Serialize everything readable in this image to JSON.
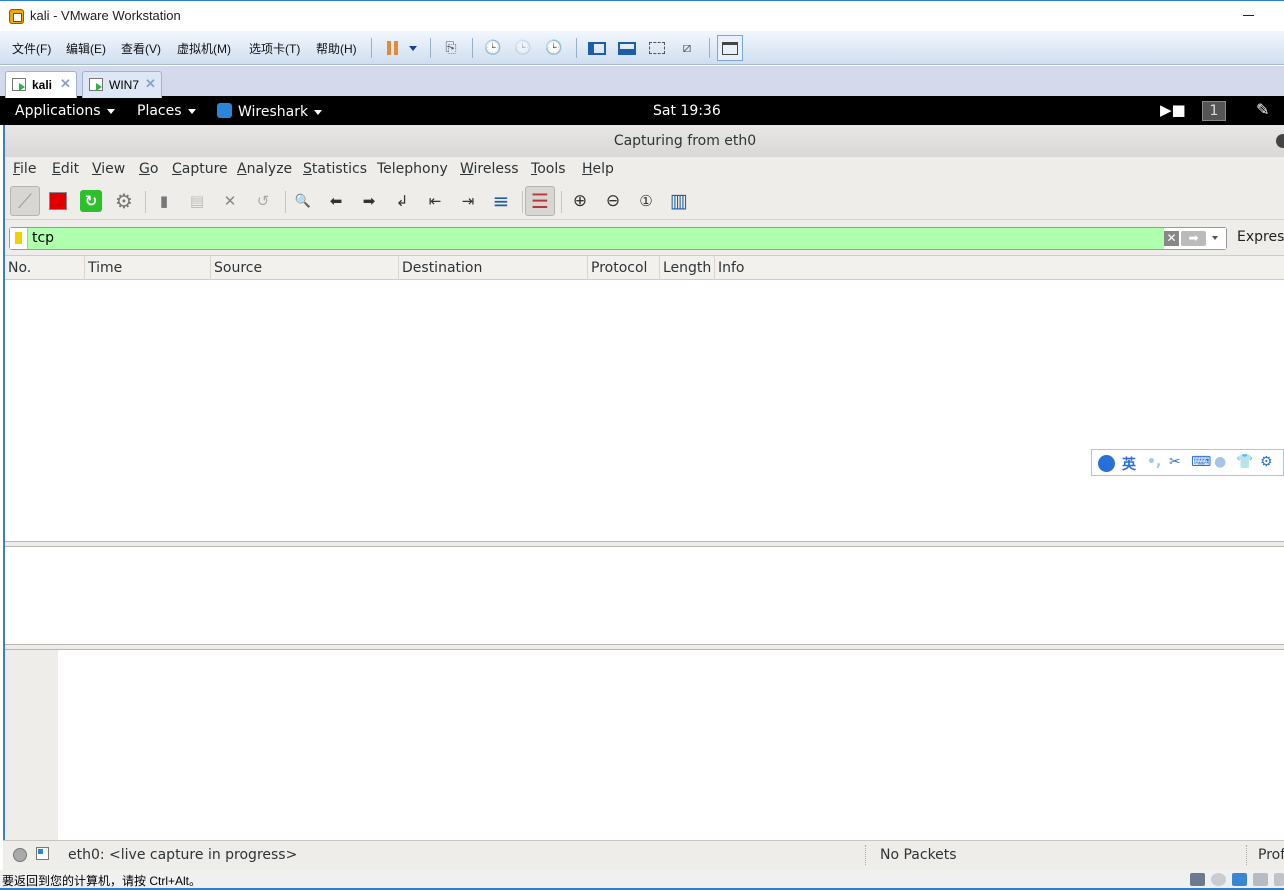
{
  "vmware": {
    "window_title": "kali - VMware Workstation",
    "menu": [
      "文件(F)",
      "编辑(E)",
      "查看(V)",
      "虚拟机(M)",
      "选项卡(T)",
      "帮助(H)"
    ],
    "toolbar_icons": [
      "pause-icon",
      "dropdown-icon",
      "send-ctrl-alt-del-icon",
      "snapshot-take-icon",
      "snapshot-revert-icon",
      "snapshot-manager-icon",
      "show-library-icon",
      "thumbnail-bar-icon",
      "full-screen-icon",
      "unity-icon",
      "console-view-icon"
    ],
    "tabs": [
      {
        "label": "kali",
        "active": true
      },
      {
        "label": "WIN7",
        "active": false
      }
    ],
    "status_message": "要返回到您的计算机，请按 Ctrl+Alt。",
    "device_icons": [
      "hard-disk-icon",
      "cd-dvd-icon",
      "network-icon",
      "printer-icon",
      "sound-icon"
    ]
  },
  "kali_panel": {
    "applications": "Applications",
    "places": "Places",
    "app": "Wireshark",
    "clock": "Sat 19:36",
    "workspace": "1"
  },
  "wireshark": {
    "title": "Capturing from eth0",
    "menu": [
      {
        "u": "F",
        "rest": "ile"
      },
      {
        "u": "E",
        "rest": "dit"
      },
      {
        "u": "V",
        "rest": "iew"
      },
      {
        "u": "G",
        "rest": "o"
      },
      {
        "u": "C",
        "rest": "apture"
      },
      {
        "u": "A",
        "rest": "nalyze"
      },
      {
        "u": "S",
        "rest": "tatistics"
      },
      {
        "u": "",
        "rest": "Telephony"
      },
      {
        "u": "W",
        "rest": "ireless"
      },
      {
        "u": "T",
        "rest": "ools"
      },
      {
        "u": "H",
        "rest": "elp"
      }
    ],
    "toolbar": {
      "start": "⟋",
      "stop": "■",
      "restart": "↻",
      "options": "⚙",
      "open": "▮",
      "save": "▤",
      "close": "✕",
      "reload": "↺",
      "find": "🔍",
      "back": "⬅",
      "forward": "➡",
      "goto": "↲",
      "first": "⇤",
      "last": "⇥",
      "autoscroll": "≡",
      "colorize": "☰",
      "zoom_in": "⊕",
      "zoom_out": "⊖",
      "zoom_normal": "①",
      "resize_columns": "▥"
    },
    "filter": {
      "value": "tcp",
      "expression_label": "Expression…"
    },
    "columns": [
      "No.",
      "Time",
      "Source",
      "Destination",
      "Protocol",
      "Length",
      "Info"
    ],
    "packets": [],
    "status": {
      "capture": "eth0: <live capture in progress>",
      "packets": "No Packets",
      "profile": "Profile: Default"
    }
  },
  "ime": {
    "lang": "英",
    "punct": "•,",
    "icons": [
      "user-icon",
      "scissors-icon",
      "keyboard-icon",
      "person-icon",
      "skin-icon",
      "settings-icon"
    ]
  }
}
